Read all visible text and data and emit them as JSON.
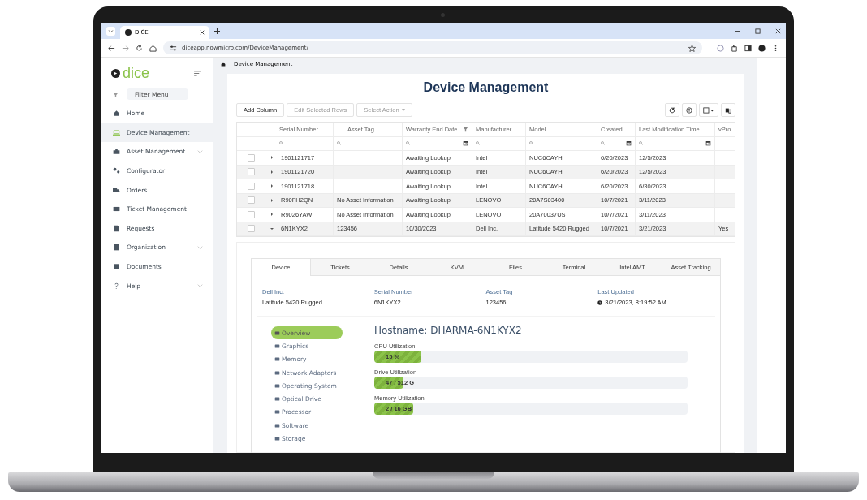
{
  "browser": {
    "tab_title": "DICE",
    "url": "diceapp.nowmicro.com/DeviceManagement/"
  },
  "sidebar": {
    "logo": "dice",
    "filter_placeholder": "Filter Menu",
    "items": [
      {
        "label": "Home",
        "selected": false,
        "expandable": false
      },
      {
        "label": "Device Management",
        "selected": true,
        "expandable": false
      },
      {
        "label": "Asset Management",
        "selected": false,
        "expandable": true
      },
      {
        "label": "Configurator",
        "selected": false,
        "expandable": false
      },
      {
        "label": "Orders",
        "selected": false,
        "expandable": false
      },
      {
        "label": "Ticket Management",
        "selected": false,
        "expandable": false
      },
      {
        "label": "Requests",
        "selected": false,
        "expandable": false
      },
      {
        "label": "Organization",
        "selected": false,
        "expandable": true
      },
      {
        "label": "Documents",
        "selected": false,
        "expandable": false
      },
      {
        "label": "Help",
        "selected": false,
        "expandable": true
      }
    ]
  },
  "breadcrumb": "Device Management",
  "page_title": "Device Management",
  "toolbar": {
    "buttons": [
      {
        "label": "Add Column",
        "disabled": false,
        "dropdown": false
      },
      {
        "label": "Edit Selected Rows",
        "disabled": true,
        "dropdown": false
      },
      {
        "label": "Select Action",
        "disabled": true,
        "dropdown": true
      }
    ]
  },
  "table": {
    "columns": [
      {
        "label": "Serial Number",
        "search": true,
        "date_picker": false,
        "filtered": false
      },
      {
        "label": "Asset Tag",
        "search": true,
        "date_picker": false,
        "filtered": false
      },
      {
        "label": "Warranty End Date",
        "search": true,
        "date_picker": true,
        "filtered": true
      },
      {
        "label": "Manufacturer",
        "search": true,
        "date_picker": false,
        "filtered": false
      },
      {
        "label": "Model",
        "search": true,
        "date_picker": false,
        "filtered": false
      },
      {
        "label": "Created",
        "search": true,
        "date_picker": true,
        "filtered": false
      },
      {
        "label": "Last Modification Time",
        "search": true,
        "date_picker": true,
        "filtered": false
      },
      {
        "label": "vPro",
        "search": false,
        "date_picker": false,
        "filtered": false
      }
    ],
    "rows": [
      {
        "checked": false,
        "expanded": false,
        "cells": [
          "1901121717",
          "",
          "Awaiting Lookup",
          "Intel",
          "NUC6CAYH",
          "6/20/2023",
          "12/5/2023",
          ""
        ]
      },
      {
        "checked": false,
        "expanded": false,
        "cells": [
          "1901121720",
          "",
          "Awaiting Lookup",
          "Intel",
          "NUC6CAYH",
          "6/20/2023",
          "12/5/2023",
          ""
        ]
      },
      {
        "checked": false,
        "expanded": false,
        "cells": [
          "1901121718",
          "",
          "Awaiting Lookup",
          "Intel",
          "NUC6CAYH",
          "6/20/2023",
          "6/30/2023",
          ""
        ]
      },
      {
        "checked": false,
        "expanded": false,
        "cells": [
          "R90FH2QN",
          "No Asset Information",
          "Awaiting Lookup",
          "LENOVO",
          "20A7S03400",
          "10/7/2021",
          "3/11/2023",
          ""
        ]
      },
      {
        "checked": false,
        "expanded": false,
        "cells": [
          "R9026YAW",
          "No Asset Information",
          "Awaiting Lookup",
          "LENOVO",
          "20A70037US",
          "10/7/2021",
          "3/11/2023",
          ""
        ]
      },
      {
        "checked": false,
        "expanded": true,
        "cells": [
          "6N1KYX2",
          "123456",
          "10/30/2023",
          "Dell Inc.",
          "Latitude 5420 Rugged",
          "10/7/2021",
          "3/21/2023",
          "Yes"
        ]
      }
    ]
  },
  "detail": {
    "tabs": [
      {
        "label": "Device",
        "selected": true
      },
      {
        "label": "Tickets",
        "selected": false
      },
      {
        "label": "Details",
        "selected": false
      },
      {
        "label": "KVM",
        "selected": false
      },
      {
        "label": "Files",
        "selected": false
      },
      {
        "label": "Terminal",
        "selected": false
      },
      {
        "label": "Intel AMT",
        "selected": false
      },
      {
        "label": "Asset Tracking",
        "selected": false
      }
    ],
    "fields": [
      {
        "label": "Dell Inc.",
        "value": "Latitude 5420 Rugged",
        "kind": "plain"
      },
      {
        "label": "Serial Number",
        "value": "6N1KYX2",
        "kind": "plain"
      },
      {
        "label": "Asset Tag",
        "value": "123456",
        "kind": "plain"
      },
      {
        "label": "Last Updated",
        "value": "3/21/2023, 8:19:52 AM",
        "kind": "time"
      }
    ],
    "nav": [
      {
        "label": "Overview",
        "selected": true
      },
      {
        "label": "Graphics",
        "selected": false
      },
      {
        "label": "Memory",
        "selected": false
      },
      {
        "label": "Network Adapters",
        "selected": false
      },
      {
        "label": "Operating System",
        "selected": false
      },
      {
        "label": "Optical Drive",
        "selected": false
      },
      {
        "label": "Processor",
        "selected": false
      },
      {
        "label": "Software",
        "selected": false
      },
      {
        "label": "Storage",
        "selected": false
      }
    ],
    "hostname": "Hostname: DHARMA-6N1KYX2",
    "meters": [
      {
        "label": "CPU Utilization",
        "reading": "15 %",
        "level": 0.15
      },
      {
        "label": "Drive Utilization",
        "reading": "47 / 512 G",
        "level": 0.092
      },
      {
        "label": "Memory Utilization",
        "reading": "2 / 16 GB",
        "level": 0.125
      }
    ]
  }
}
